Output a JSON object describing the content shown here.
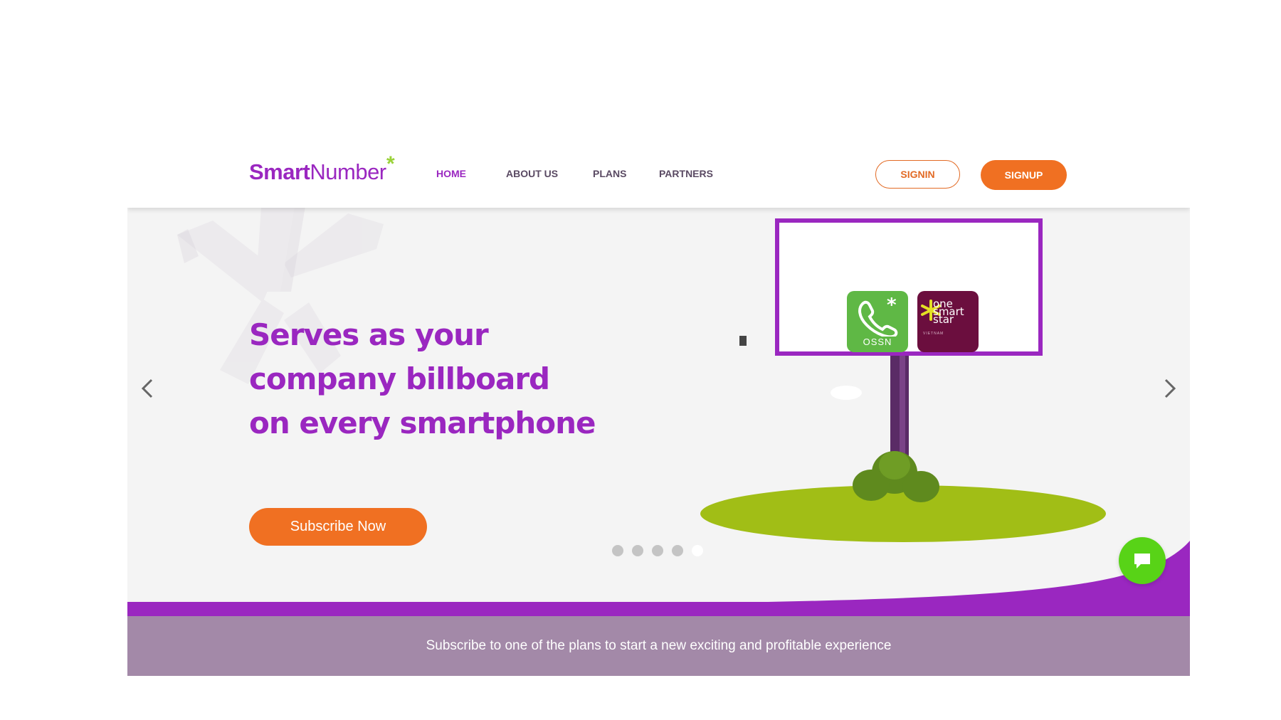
{
  "brand": {
    "name_bold": "Smart",
    "name_regular": "Number",
    "star": "*"
  },
  "nav": [
    {
      "label": "HOME",
      "active": true
    },
    {
      "label": "ABOUT US",
      "active": false
    },
    {
      "label": "PLANS",
      "active": false
    },
    {
      "label": "PARTNERS",
      "active": false
    }
  ],
  "auth": {
    "signin_label": "SIGNIN",
    "signup_label": "SIGNUP"
  },
  "hero": {
    "title_lines": [
      "Serves as your",
      "company billboard",
      "on every smartphone"
    ],
    "cta_label": "Subscribe Now",
    "slides_total": 5,
    "active_slide": 5
  },
  "billboard": {
    "app1_label": "OSSN",
    "app2_label_line1": "one",
    "app2_label_line2": "smart",
    "app2_label_line3": "star",
    "app2_sub": "VIETNAM"
  },
  "footer_band": {
    "text": "Subscribe to one of the plans to start a new exciting and profitable experience"
  },
  "icons": {
    "prev": "chevron-left-icon",
    "next": "chevron-right-icon",
    "chat": "chat-bubble-icon"
  },
  "colors": {
    "brand_purple": "#9a27c0",
    "accent_orange": "#f07022",
    "chat_green": "#58d317",
    "band_lilac": "#a389a8"
  }
}
